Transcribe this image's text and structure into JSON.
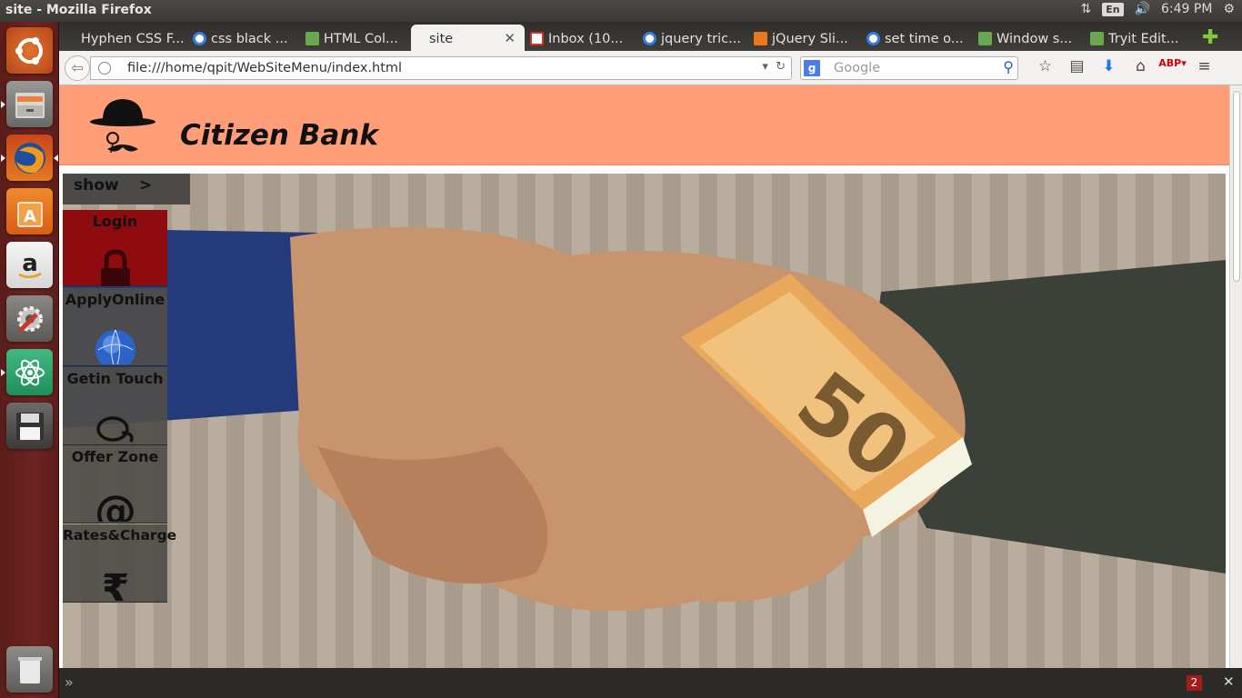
{
  "window": {
    "title": "site - Mozilla Firefox"
  },
  "system_tray": {
    "keyboard": "En",
    "time": "6:49 PM"
  },
  "tabs": [
    {
      "label": "Hyphen CSS F...",
      "icon": "document-icon"
    },
    {
      "label": "css black ...",
      "icon": "google-icon"
    },
    {
      "label": "HTML Col...",
      "icon": "w3-icon"
    },
    {
      "label": "site",
      "icon": "none",
      "active": true
    },
    {
      "label": "Inbox (10...",
      "icon": "gmail-icon"
    },
    {
      "label": "jquery tric...",
      "icon": "google-icon"
    },
    {
      "label": "jQuery Sli...",
      "icon": "star-icon"
    },
    {
      "label": "set time o...",
      "icon": "google-icon"
    },
    {
      "label": "Window s...",
      "icon": "w3-icon"
    },
    {
      "label": "Tryit Edit...",
      "icon": "w3-icon"
    }
  ],
  "address_bar": {
    "url": "file:///home/qpit/WebSiteMenu/index.html"
  },
  "search_bar": {
    "placeholder": "Google"
  },
  "site": {
    "brand": "Citizen Bank",
    "show_label": "show",
    "show_arrow": ">",
    "menu": [
      {
        "label": "Login",
        "icon": "lock-icon",
        "active": true
      },
      {
        "label": "ApplyOnline",
        "icon": "globe-icon"
      },
      {
        "label": "Getin Touch",
        "icon": "chat-bubbles-icon"
      },
      {
        "label": "Offer Zone",
        "icon": "at-sign-icon"
      },
      {
        "label": "Rates&Charge",
        "icon": "rupee-icon"
      }
    ]
  },
  "addon_bar": {
    "badge_count": "2"
  },
  "colors": {
    "header": "#ff9e78",
    "menu_active": "#8e0c10",
    "menu_bg": "#504e4a",
    "launcher": "#6e2420"
  }
}
